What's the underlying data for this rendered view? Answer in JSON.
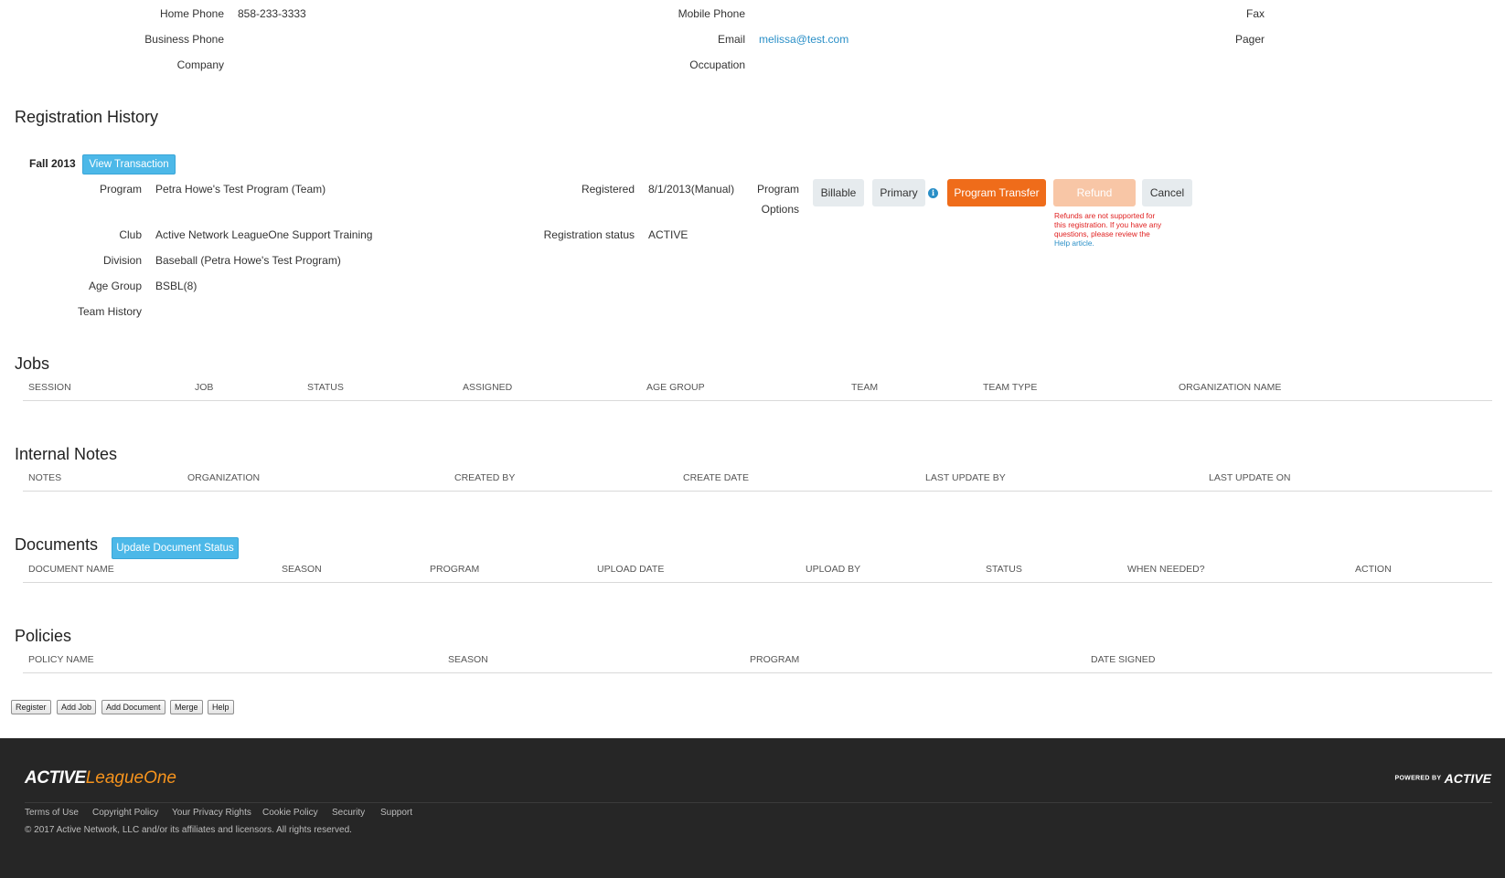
{
  "contact": {
    "home_phone_label": "Home Phone",
    "home_phone": "858-233-3333",
    "business_phone_label": "Business Phone",
    "company_label": "Company",
    "mobile_phone_label": "Mobile Phone",
    "email_label": "Email",
    "email": "melissa@test.com",
    "occupation_label": "Occupation",
    "fax_label": "Fax",
    "pager_label": "Pager"
  },
  "registration_history": {
    "title": "Registration History",
    "season": "Fall 2013",
    "view_transaction": "View Transaction",
    "program_label": "Program",
    "program": "Petra Howe's Test Program (Team)",
    "club_label": "Club",
    "club": "Active Network LeagueOne Support Training",
    "division_label": "Division",
    "division": "Baseball (Petra Howe's Test Program)",
    "age_group_label": "Age Group",
    "age_group": "BSBL(8)",
    "team_history_label": "Team History",
    "registered_label": "Registered",
    "registered": "8/1/2013(Manual)",
    "status_label": "Registration status",
    "status": "ACTIVE",
    "program_options_label_1": "Program",
    "program_options_label_2": "Options",
    "billable": "Billable",
    "primary": "Primary",
    "program_transfer": "Program Transfer",
    "refund": "Refund",
    "cancel": "Cancel",
    "refund_note": "Refunds are not supported for this registration. If you have any questions, please review the ",
    "refund_link": "Help article."
  },
  "jobs": {
    "title": "Jobs",
    "columns": [
      "SESSION",
      "JOB",
      "STATUS",
      "ASSIGNED",
      "AGE GROUP",
      "TEAM",
      "TEAM TYPE",
      "ORGANIZATION NAME"
    ]
  },
  "internal_notes": {
    "title": "Internal Notes",
    "columns": [
      "NOTES",
      "ORGANIZATION",
      "CREATED BY",
      "CREATE DATE",
      "LAST UPDATE BY",
      "LAST UPDATE ON"
    ]
  },
  "documents": {
    "title": "Documents",
    "update_button": "Update Document Status",
    "columns": [
      "DOCUMENT NAME",
      "SEASON",
      "PROGRAM",
      "UPLOAD DATE",
      "UPLOAD BY",
      "STATUS",
      "WHEN NEEDED?",
      "ACTION"
    ]
  },
  "policies": {
    "title": "Policies",
    "columns": [
      "POLICY NAME",
      "SEASON",
      "PROGRAM",
      "DATE SIGNED"
    ]
  },
  "actions": {
    "register": "Register",
    "add_job": "Add Job",
    "add_document": "Add Document",
    "merge": "Merge",
    "help": "Help"
  },
  "footer": {
    "logo_active": "ACTIVE",
    "logo_leagueone": "LeagueOne",
    "powered_by": "POWERED BY",
    "powered_active": "ACTIVE",
    "links": [
      "Terms of Use",
      "Copyright Policy",
      "Your Privacy Rights",
      "Cookie Policy",
      "Security",
      "Support"
    ],
    "copyright": "©  2017  Active Network, LLC and/or its affiliates and licensors. All rights reserved."
  },
  "colors": {
    "accent_blue": "#4cb8e8",
    "link_blue": "#2a8fc7",
    "orange": "#ef6c1a",
    "footer_bg": "#262626"
  }
}
